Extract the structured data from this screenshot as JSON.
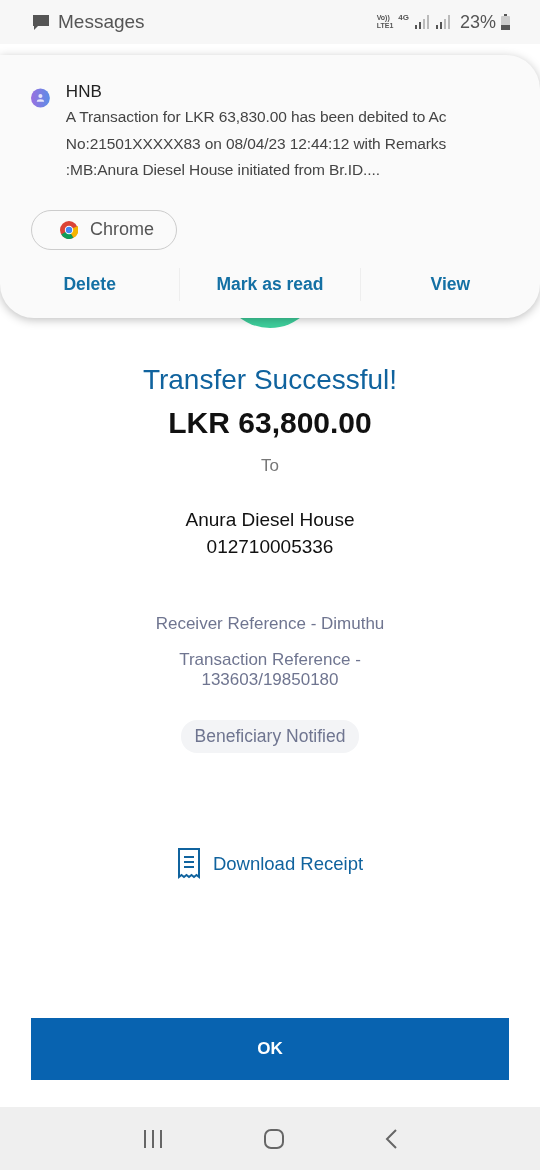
{
  "status_bar": {
    "app": "Messages",
    "volte_top": "Vo))",
    "volte_bottom": "LTE1",
    "data": "4G",
    "battery": "23%"
  },
  "notification": {
    "sender": "HNB",
    "message": "A Transaction for LKR 63,830.00 has been debited to Ac No:21501XXXXX83 on 08/04/23 12:44:12 with Remarks :MB:Anura Diesel House initiated from Br.ID....",
    "app_chip": "Chrome",
    "actions": [
      "Delete",
      "Mark as read",
      "View"
    ]
  },
  "transfer": {
    "title": "Transfer Successful!",
    "amount": "LKR 63,800.00",
    "to_label": "To",
    "payee_name": "Anura Diesel House",
    "payee_account": "012710005336",
    "receiver_reference": "Receiver Reference - Dimuthu",
    "transaction_reference_label": "Transaction Reference -",
    "transaction_reference_value": "133603/19850180",
    "status_badge": "Beneficiary Notified",
    "download_link": "Download Receipt",
    "ok_button": "OK"
  }
}
